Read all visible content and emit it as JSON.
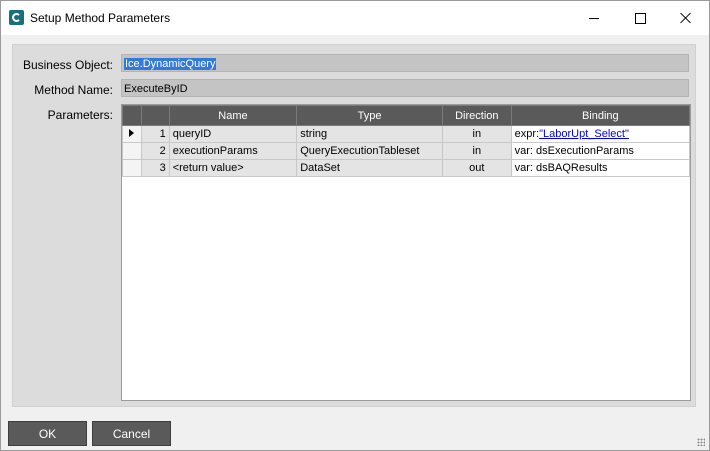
{
  "window": {
    "title": "Setup Method Parameters"
  },
  "fields": {
    "business_object_label": "Business Object:",
    "business_object_value": "Ice.DynamicQuery",
    "method_name_label": "Method Name:",
    "method_name_value": "ExecuteByID",
    "parameters_label": "Parameters:"
  },
  "grid": {
    "columns": [
      "Name",
      "Type",
      "Direction",
      "Binding"
    ],
    "rows": [
      {
        "num": "1",
        "name": "queryID",
        "type": "string",
        "direction": "in",
        "binding_prefix": "expr:",
        "binding_link": "\"LaborUpt_Select\"",
        "binding": ""
      },
      {
        "num": "2",
        "name": "executionParams",
        "type": "QueryExecutionTableset",
        "direction": "in",
        "binding_prefix": "",
        "binding_link": "",
        "binding": "var: dsExecutionParams"
      },
      {
        "num": "3",
        "name": "<return value>",
        "type": "DataSet",
        "direction": "out",
        "binding_prefix": "",
        "binding_link": "",
        "binding": "var: dsBAQResults"
      }
    ]
  },
  "buttons": {
    "ok": "OK",
    "cancel": "Cancel"
  }
}
